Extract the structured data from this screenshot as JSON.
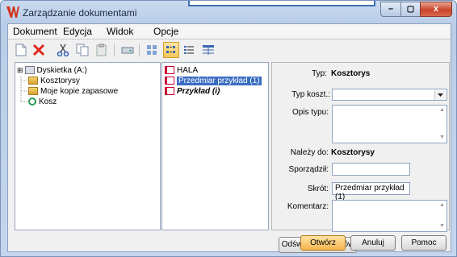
{
  "window": {
    "title": "Zarządzanie dokumentami",
    "min_label": "–",
    "max_label": "▢",
    "close_label": "x"
  },
  "menu": [
    {
      "label": "Dokument"
    },
    {
      "label": "Edycja"
    },
    {
      "label": "Widok"
    },
    {
      "label": "Opcje"
    }
  ],
  "toolbar": {
    "icons": [
      "new-document-icon",
      "delete-icon",
      "cut-icon",
      "copy-icon",
      "paste-icon",
      "drive-icon",
      "large-icons-view-icon",
      "small-icons-view-icon",
      "list-view-icon",
      "details-view-icon"
    ],
    "active": "small-icons-view-icon"
  },
  "tree": {
    "items": [
      {
        "label": "Dyskietka (A:)",
        "expander": "⊞"
      },
      {
        "label": "Kosztorysy"
      },
      {
        "label": "Moje kopie zapasowe"
      },
      {
        "label": "Kosz"
      }
    ]
  },
  "files": {
    "items": [
      {
        "label": "HALA"
      },
      {
        "label": "Przedmiar przykład (1)",
        "selected": true
      },
      {
        "label": "Przykład (i)"
      }
    ]
  },
  "props": {
    "typ_label": "Typ:",
    "typ_value": "Kosztorys",
    "typ_koszt_label": "Typ koszt.:",
    "typ_koszt_value": "",
    "opis_label": "Opis typu:",
    "opis_value": "",
    "nalezy_label": "Należy do:",
    "nalezy_value": "Kosztorysy",
    "sporzadzil_label": "Sporządził:",
    "sporzadzil_value": "",
    "skrot_label": "Skrót:",
    "skrot_value": "Przedmiar przykład (1)",
    "komentarz_label": "Komentarz:",
    "komentarz_value": "",
    "refresh_label": "Odśwież listę plików"
  },
  "buttons": {
    "open": "Otwórz",
    "cancel": "Anuluj",
    "help": "Pomoc"
  },
  "colors": {
    "selection": "#3b6ec2",
    "default_button": "#f6b54e",
    "close_button": "#c8452b"
  }
}
